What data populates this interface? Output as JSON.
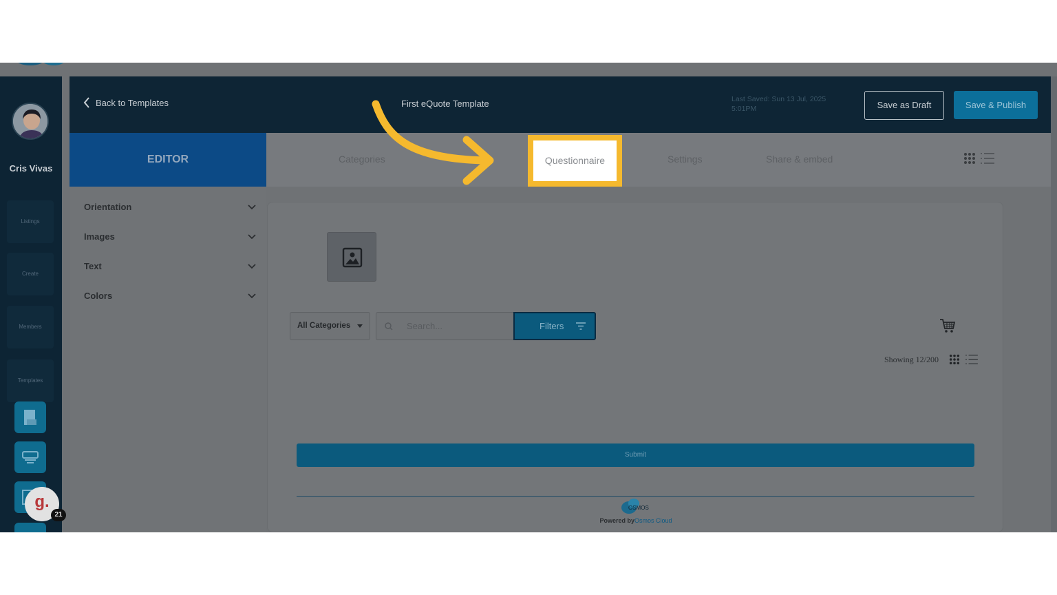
{
  "sidebar": {
    "user_name": "Cris Vivas",
    "nav_items": [
      "Listings",
      "Create",
      "Members",
      "Templates"
    ],
    "badge_letter": "g.",
    "badge_count": "21"
  },
  "header": {
    "back_label": "Back to Templates",
    "template_title": "First eQuote Template",
    "last_saved_line1": "Last Saved: Sun 13 Jul, 2025",
    "last_saved_line2": "5:01PM",
    "save_draft_label": "Save as Draft",
    "save_publish_label": "Save & Publish"
  },
  "tabs": {
    "editor_label": "EDITOR",
    "categories_label": "Categories",
    "questionnaire_label": "Questionnaire",
    "settings_label": "Settings",
    "share_label": "Share & embed"
  },
  "panel": {
    "orientation_label": "Orientation",
    "images_label": "Images",
    "text_label": "Text",
    "colors_label": "Colors"
  },
  "preview": {
    "category_value": "All Categories",
    "search_placeholder": "Search...",
    "filters_label": "Filters",
    "showing_text": "Showing 12/200",
    "submit_label": "Submit",
    "powered_by": "Powered by",
    "powered_link": "Osmos Cloud",
    "footer_logo_text": "OSMOS"
  },
  "colors": {
    "highlight": "#f5b92e",
    "arrow": "#f5b92e",
    "accent_blue": "#0c6f9a",
    "dark_navy": "#0e2535"
  }
}
